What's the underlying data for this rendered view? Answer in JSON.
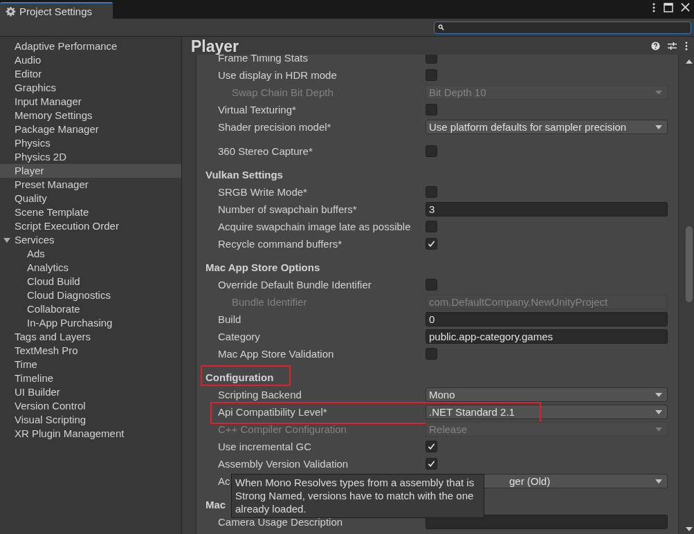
{
  "window": {
    "tab_title": "Project Settings"
  },
  "sidebar": {
    "items": [
      {
        "label": "Adaptive Performance",
        "selected": false
      },
      {
        "label": "Audio",
        "selected": false
      },
      {
        "label": "Editor",
        "selected": false
      },
      {
        "label": "Graphics",
        "selected": false
      },
      {
        "label": "Input Manager",
        "selected": false
      },
      {
        "label": "Memory Settings",
        "selected": false
      },
      {
        "label": "Package Manager",
        "selected": false
      },
      {
        "label": "Physics",
        "selected": false
      },
      {
        "label": "Physics 2D",
        "selected": false
      },
      {
        "label": "Player",
        "selected": true
      },
      {
        "label": "Preset Manager",
        "selected": false
      },
      {
        "label": "Quality",
        "selected": false
      },
      {
        "label": "Scene Template",
        "selected": false
      },
      {
        "label": "Script Execution Order",
        "selected": false
      },
      {
        "label": "Services",
        "selected": false,
        "expanded": true,
        "children": [
          {
            "label": "Ads",
            "selected": false
          },
          {
            "label": "Analytics",
            "selected": false
          },
          {
            "label": "Cloud Build",
            "selected": false
          },
          {
            "label": "Cloud Diagnostics",
            "selected": false
          },
          {
            "label": "Collaborate",
            "selected": false
          },
          {
            "label": "In-App Purchasing",
            "selected": false
          }
        ]
      },
      {
        "label": "Tags and Layers",
        "selected": false
      },
      {
        "label": "TextMesh Pro",
        "selected": false
      },
      {
        "label": "Time",
        "selected": false
      },
      {
        "label": "Timeline",
        "selected": false
      },
      {
        "label": "UI Builder",
        "selected": false
      },
      {
        "label": "Version Control",
        "selected": false
      },
      {
        "label": "Visual Scripting",
        "selected": false
      },
      {
        "label": "XR Plugin Management",
        "selected": false
      }
    ]
  },
  "page": {
    "title": "Player"
  },
  "rows": [
    {
      "kind": "checkbox",
      "label": "Frame Timing Stats",
      "checked": false
    },
    {
      "kind": "checkbox",
      "label": "Use display in HDR mode",
      "checked": false,
      "children": [
        {
          "kind": "dropdown",
          "label": "Swap Chain Bit Depth",
          "value": "Bit Depth 10",
          "disabled": true
        }
      ]
    },
    {
      "kind": "checkbox",
      "label": "Virtual Texturing*",
      "checked": false
    },
    {
      "kind": "dropdown",
      "label": "Shader precision model*",
      "value": "Use platform defaults for sampler precision",
      "disabled": false
    },
    {
      "kind": "gap"
    },
    {
      "kind": "checkbox",
      "label": "360 Stereo Capture*",
      "checked": false
    },
    {
      "kind": "heading",
      "label": "Vulkan Settings",
      "highlighted": false
    },
    {
      "kind": "checkbox",
      "label": "SRGB Write Mode*",
      "checked": false
    },
    {
      "kind": "field",
      "label": "Number of swapchain buffers*",
      "value": "3",
      "disabled": false
    },
    {
      "kind": "checkbox",
      "label": "Acquire swapchain image late as possible",
      "checked": false
    },
    {
      "kind": "checkbox",
      "label": "Recycle command buffers*",
      "checked": true
    },
    {
      "kind": "heading",
      "label": "Mac App Store Options",
      "highlighted": false
    },
    {
      "kind": "checkbox",
      "label": "Override Default Bundle Identifier",
      "checked": false,
      "children": [
        {
          "kind": "field",
          "label": "Bundle Identifier",
          "value": "com.DefaultCompany.NewUnityProject",
          "disabled": true
        }
      ]
    },
    {
      "kind": "field",
      "label": "Build",
      "value": "0",
      "disabled": false
    },
    {
      "kind": "field",
      "label": "Category",
      "value": "public.app-category.games",
      "disabled": false
    },
    {
      "kind": "checkbox",
      "label": "Mac App Store Validation",
      "checked": false
    },
    {
      "kind": "heading",
      "label": "Configuration",
      "highlighted": true
    },
    {
      "kind": "dropdown",
      "label": "Scripting Backend",
      "value": "Mono",
      "disabled": false
    },
    {
      "kind": "dropdown",
      "label": "Api Compatibility Level*",
      "value": ".NET Standard 2.1",
      "disabled": false,
      "highlighted": true
    },
    {
      "kind": "dropdown",
      "label": "C++ Compiler Configuration",
      "value": "Release",
      "disabled": true
    },
    {
      "kind": "checkbox",
      "label": "Use incremental GC",
      "checked": true
    },
    {
      "kind": "checkbox",
      "label": "Assembly Version Validation",
      "checked": true
    },
    {
      "kind": "dropdown",
      "label": "Ac",
      "value": "ger (Old)",
      "disabled": false,
      "covered": true
    },
    {
      "kind": "heading",
      "label": "Mac",
      "highlighted": false
    },
    {
      "kind": "field",
      "label": "Camera Usage Description",
      "disabled": false
    }
  ],
  "tooltip": {
    "text": "When Mono Resolves types from a assembly that is Strong Named, versions have to match with the one already loaded."
  }
}
